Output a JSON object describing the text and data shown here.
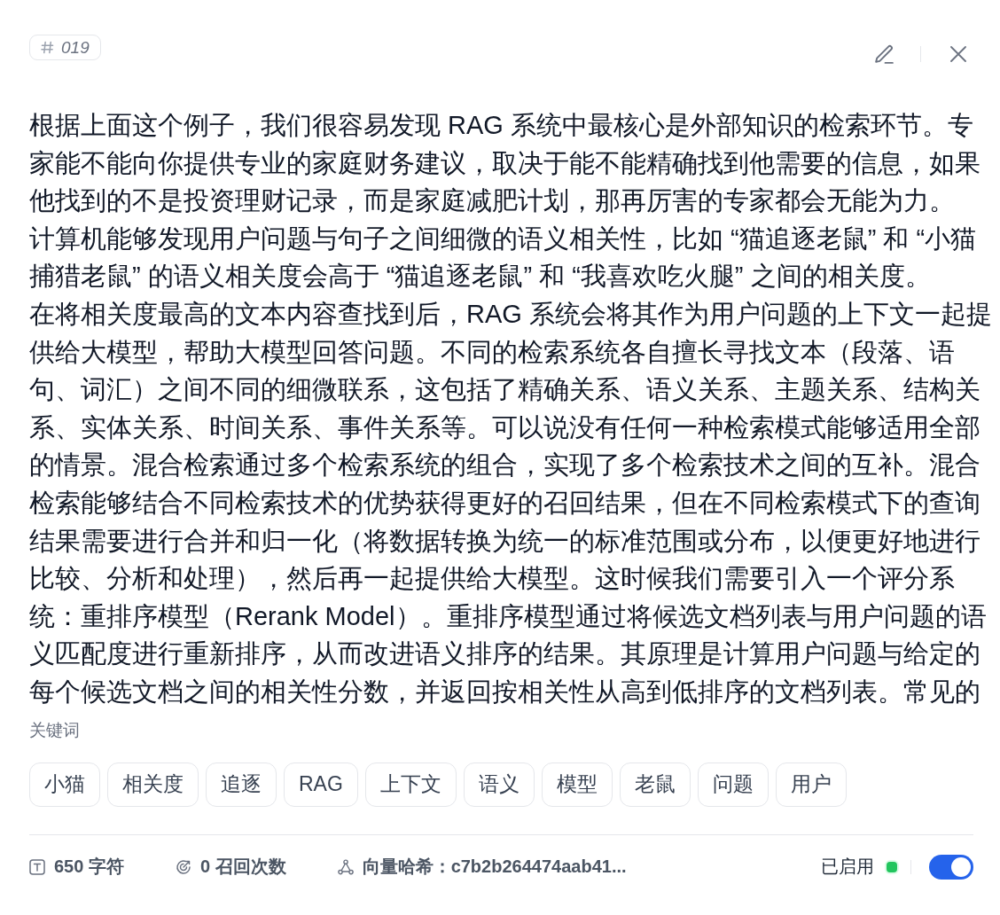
{
  "tag": {
    "label": "019"
  },
  "content": {
    "paragraphs": [
      "根据上面这个例子，我们很容易发现 RAG 系统中最核心是外部知识的检索环节。专家能不能向你提供专业的家庭财务建议，取决于能不能精确找到他需要的信息，如果他找到的不是投资理财记录，而是家庭减肥计划，那再厉害的专家都会无能为力。",
      "计算机能够发现用户问题与句子之间细微的语义相关性，比如 “猫追逐老鼠” 和 “小猫捕猎老鼠” 的语义相关度会高于 “猫追逐老鼠” 和 “我喜欢吃火腿” 之间的相关度。",
      "在将相关度最高的文本内容查找到后，RAG 系统会将其作为用户问题的上下文一起提供给大模型，帮助大模型回答问题。不同的检索系统各自擅长寻找文本（段落、语句、词汇）之间不同的细微联系，这包括了精确关系、语义关系、主题关系、结构关系、实体关系、时间关系、事件关系等。可以说没有任何一种检索模式能够适用全部的情景。混合检索通过多个检索系统的组合，实现了多个检索技术之间的互补。混合检索能够结合不同检索技术的优势获得更好的召回结果，但在不同检索模式下的查询结果需要进行合并和归一化（将数据转换为统一的标准范围或分布，以便更好地进行比较、分析和处理），然后再一起提供给大模型。这时候我们需要引入一个评分系统：重排序模型（Rerank Model）。重排序模型通过将候选文档列表与用户问题的语义匹配度进行重新排序，从而改进语义排序的结果。其原理是计算用户问题与给定的每个候选文档之间的相关性分数，并返回按相关性从高到低排序的文档列表。常见的"
    ]
  },
  "keywords": {
    "label": "关键词",
    "items": [
      "小猫",
      "相关度",
      "追逐",
      "RAG",
      "上下文",
      "语义",
      "模型",
      "老鼠",
      "问题",
      "用户"
    ]
  },
  "footer": {
    "stats": [
      {
        "kind": "characters",
        "text": "650 字符"
      },
      {
        "kind": "recalls",
        "text": "0 召回次数"
      },
      {
        "kind": "vector_hash",
        "text": "向量哈希：c7b2b264474aab41..."
      }
    ],
    "status": {
      "label": "已启用",
      "enabled": true
    }
  }
}
